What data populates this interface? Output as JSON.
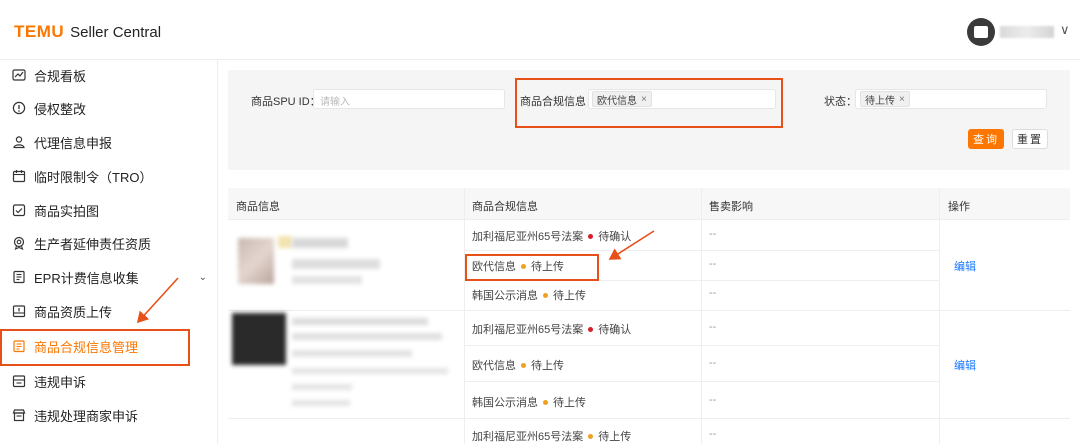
{
  "header": {
    "brand": "TEMU",
    "product": "Seller Central",
    "user_chevron": "∨"
  },
  "sidebar": {
    "items": [
      {
        "label": "合规看板",
        "icon": "chart-icon"
      },
      {
        "label": "侵权整改",
        "icon": "alert-circle-icon"
      },
      {
        "label": "代理信息申报",
        "icon": "user-icon"
      },
      {
        "label": "临时限制令（TRO）",
        "icon": "calendar-icon"
      },
      {
        "label": "商品实拍图",
        "icon": "camera-frame-icon"
      },
      {
        "label": "生产者延伸责任资质",
        "icon": "badge-icon"
      },
      {
        "label": "EPR计费信息收集",
        "icon": "document-icon"
      },
      {
        "label": "商品资质上传",
        "icon": "upload-tray-icon"
      },
      {
        "label": "商品合规信息管理",
        "icon": "clipboard-icon"
      },
      {
        "label": "违规申诉",
        "icon": "inbox-icon"
      },
      {
        "label": "违规处理商家申诉",
        "icon": "store-icon"
      }
    ],
    "active_index": 8
  },
  "filters": {
    "spu_label": "商品SPU ID：",
    "spu_placeholder": "请输入",
    "compliance_label": "商品合规信息：",
    "compliance_tag": "欧代信息",
    "status_label": "状态：",
    "status_tag": "待上传",
    "tag_close": "×",
    "query_button": "查询",
    "reset_button": "重置"
  },
  "table": {
    "columns": [
      "商品信息",
      "商品合规信息",
      "售卖影响",
      "操作"
    ],
    "rows": [
      {
        "items": [
          {
            "name": "加利福尼亚州65号法案",
            "status": "待确认",
            "status_color": "#d4202a",
            "impact": "--"
          },
          {
            "name": "欧代信息",
            "status": "待上传",
            "status_color": "#f0a020",
            "impact": "--"
          },
          {
            "name": "韩国公示消息",
            "status": "待上传",
            "status_color": "#f0a020",
            "impact": "--"
          }
        ],
        "action": "编辑"
      },
      {
        "items": [
          {
            "name": "加利福尼亚州65号法案",
            "status": "待确认",
            "status_color": "#d4202a",
            "impact": "--"
          },
          {
            "name": "欧代信息",
            "status": "待上传",
            "status_color": "#f0a020",
            "impact": "--"
          },
          {
            "name": "韩国公示消息",
            "status": "待上传",
            "status_color": "#f0a020",
            "impact": "--"
          }
        ],
        "action": "编辑"
      },
      {
        "items": [
          {
            "name": "加利福尼亚州65号法案",
            "status": "待上传",
            "status_color": "#f0a020",
            "impact": "--"
          }
        ],
        "action": ""
      }
    ]
  },
  "colors": {
    "brand": "#fb7701",
    "highlight": "#e8501a",
    "link": "#1677ff"
  }
}
